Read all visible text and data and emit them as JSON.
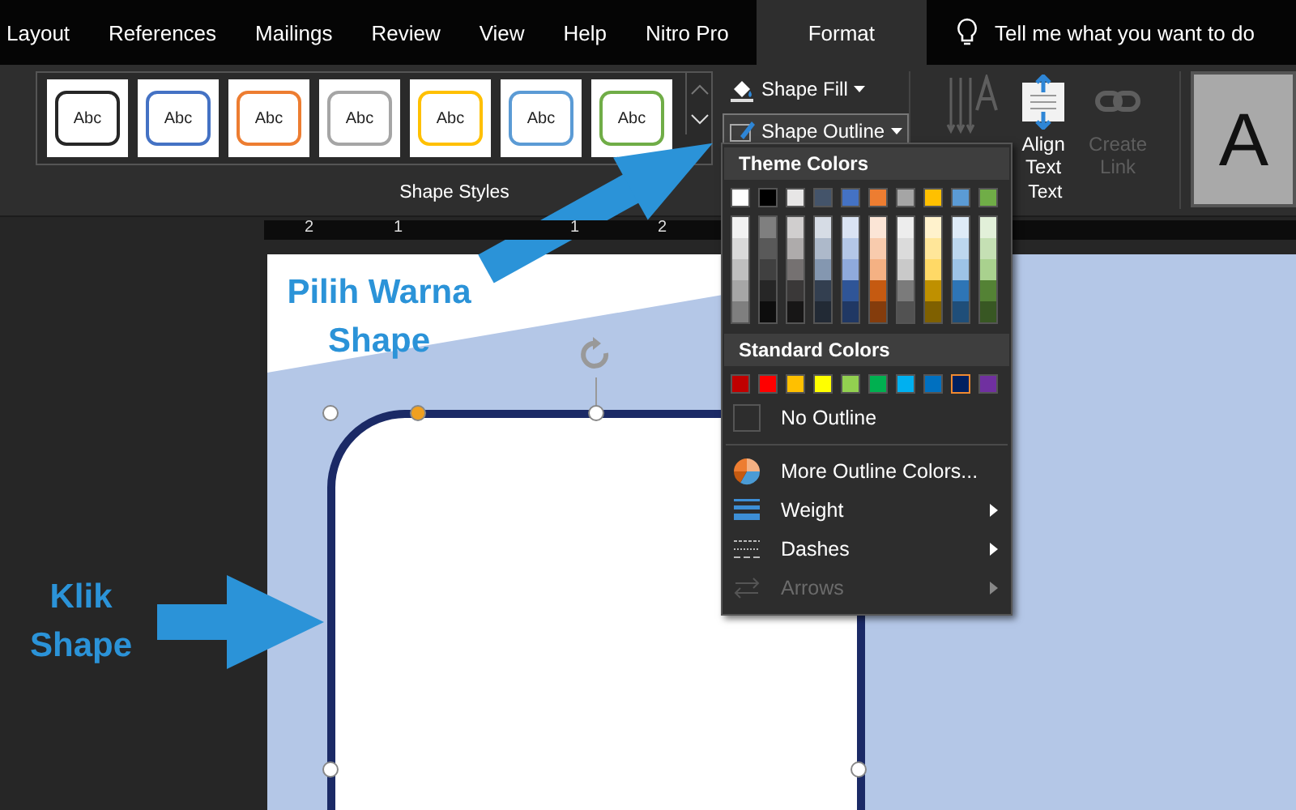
{
  "tabs": [
    {
      "label": "Layout",
      "selected": false
    },
    {
      "label": "References",
      "selected": false
    },
    {
      "label": "Mailings",
      "selected": false
    },
    {
      "label": "Review",
      "selected": false
    },
    {
      "label": "View",
      "selected": false
    },
    {
      "label": "Help",
      "selected": false
    },
    {
      "label": "Nitro Pro",
      "selected": false
    },
    {
      "label": "Format",
      "selected": true
    }
  ],
  "tell_me": "Tell me what you want to do",
  "ribbon": {
    "style_gallery": [
      {
        "label": "Abc",
        "color": "#262626"
      },
      {
        "label": "Abc",
        "color": "#4472c4"
      },
      {
        "label": "Abc",
        "color": "#ed7d31"
      },
      {
        "label": "Abc",
        "color": "#a5a5a5"
      },
      {
        "label": "Abc",
        "color": "#ffc000"
      },
      {
        "label": "Abc",
        "color": "#5b9bd5"
      },
      {
        "label": "Abc",
        "color": "#70ad47"
      }
    ],
    "styles_group": "Shape Styles",
    "shape_fill": {
      "label": "Shape Fill"
    },
    "shape_outline": {
      "label": "Shape Outline",
      "expanded": true
    },
    "text_group": "Text",
    "text_buttons": [
      {
        "kind": "direction",
        "disabled": true
      },
      {
        "kind": "align",
        "label": "Align Text",
        "disabled": false
      },
      {
        "kind": "link",
        "label": "Create Link",
        "disabled": true
      }
    ],
    "wordart": {
      "label": "A"
    }
  },
  "outline_menu": {
    "theme_header": "Theme Colors",
    "theme_colors": [
      {
        "color": "#ffffff",
        "shades": [
          {
            "color": "#f2f2f2"
          },
          {
            "color": "#d9d9d9"
          },
          {
            "color": "#bfbfbf"
          },
          {
            "color": "#a6a6a6"
          },
          {
            "color": "#7f7f7f"
          }
        ]
      },
      {
        "color": "#000000",
        "shades": [
          {
            "color": "#7f7f7f"
          },
          {
            "color": "#595959"
          },
          {
            "color": "#404040"
          },
          {
            "color": "#262626"
          },
          {
            "color": "#0d0d0d"
          }
        ]
      },
      {
        "color": "#e7e6e6",
        "shades": [
          {
            "color": "#d0cece"
          },
          {
            "color": "#aeabab"
          },
          {
            "color": "#757171"
          },
          {
            "color": "#3a3838"
          },
          {
            "color": "#171616"
          }
        ]
      },
      {
        "color": "#44546a",
        "shades": [
          {
            "color": "#d6dce5"
          },
          {
            "color": "#adb9ca"
          },
          {
            "color": "#8497b0"
          },
          {
            "color": "#333f50"
          },
          {
            "color": "#222a35"
          }
        ]
      },
      {
        "color": "#4472c4",
        "shades": [
          {
            "color": "#dae3f3"
          },
          {
            "color": "#b4c7e7"
          },
          {
            "color": "#8faadc"
          },
          {
            "color": "#2f5597"
          },
          {
            "color": "#203864"
          }
        ]
      },
      {
        "color": "#ed7d31",
        "shades": [
          {
            "color": "#fbe5d6"
          },
          {
            "color": "#f8cbad"
          },
          {
            "color": "#f4b183"
          },
          {
            "color": "#c55a11"
          },
          {
            "color": "#843c0c"
          }
        ]
      },
      {
        "color": "#a5a5a5",
        "shades": [
          {
            "color": "#ededed"
          },
          {
            "color": "#dbdbdb"
          },
          {
            "color": "#c9c9c9"
          },
          {
            "color": "#7b7b7b"
          },
          {
            "color": "#525252"
          }
        ]
      },
      {
        "color": "#ffc000",
        "shades": [
          {
            "color": "#fff2cc"
          },
          {
            "color": "#ffe699"
          },
          {
            "color": "#ffd966"
          },
          {
            "color": "#bf9000"
          },
          {
            "color": "#7f6000"
          }
        ]
      },
      {
        "color": "#5b9bd5",
        "shades": [
          {
            "color": "#deebf7"
          },
          {
            "color": "#bdd7ee"
          },
          {
            "color": "#9dc3e6"
          },
          {
            "color": "#2e75b6"
          },
          {
            "color": "#1f4e79"
          }
        ]
      },
      {
        "color": "#70ad47",
        "shades": [
          {
            "color": "#e2f0d9"
          },
          {
            "color": "#c5e0b4"
          },
          {
            "color": "#a9d18e"
          },
          {
            "color": "#548235"
          },
          {
            "color": "#385723"
          }
        ]
      }
    ],
    "standard_header": "Standard Colors",
    "standard_colors": [
      {
        "color": "#c00000",
        "selected": false
      },
      {
        "color": "#ff0000",
        "selected": false
      },
      {
        "color": "#ffc000",
        "selected": false
      },
      {
        "color": "#ffff00",
        "selected": false
      },
      {
        "color": "#92d050",
        "selected": false
      },
      {
        "color": "#00b050",
        "selected": false
      },
      {
        "color": "#00b0f0",
        "selected": false
      },
      {
        "color": "#0070c0",
        "selected": false
      },
      {
        "color": "#002060",
        "selected": true
      },
      {
        "color": "#7030a0",
        "selected": false
      }
    ],
    "items": [
      {
        "kind": "none",
        "label": "No Outline",
        "disabled": false,
        "submenu": false
      },
      {
        "kind": "more",
        "label": "More Outline Colors...",
        "disabled": false,
        "submenu": false
      },
      {
        "kind": "weight",
        "label": "Weight",
        "disabled": false,
        "submenu": true
      },
      {
        "kind": "dashes",
        "label": "Dashes",
        "disabled": false,
        "submenu": true
      },
      {
        "kind": "arrows",
        "label": "Arrows",
        "disabled": true,
        "submenu": true
      }
    ]
  },
  "ruler": {
    "labels": [
      "2",
      "1",
      "1",
      "2"
    ]
  },
  "annotations": [
    {
      "text": "Pilih Warna Shape",
      "kind": "top"
    },
    {
      "text": "Klik Shape",
      "kind": "left"
    }
  ]
}
